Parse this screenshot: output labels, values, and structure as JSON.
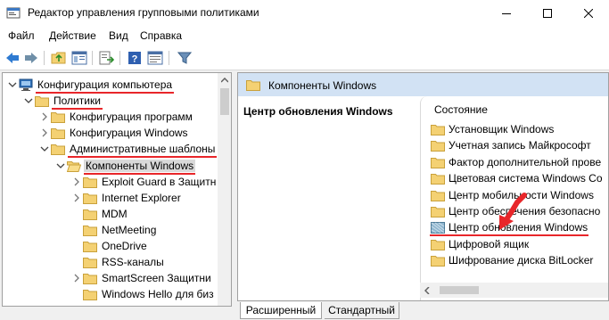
{
  "window": {
    "title": "Редактор управления групповыми политиками"
  },
  "menu": [
    "Файл",
    "Действие",
    "Вид",
    "Справка"
  ],
  "toolbar": {
    "icons": [
      "back-icon",
      "forward-icon",
      "folder-up-icon",
      "show-hide-tree-icon",
      "export-list-icon",
      "help-icon",
      "properties-icon",
      "filter-icon"
    ]
  },
  "tree": {
    "items": [
      {
        "label": "Конфигурация компьютера",
        "level": 0,
        "expander": "open",
        "icon": "computer-icon",
        "highlighted": true
      },
      {
        "label": "Политики",
        "level": 1,
        "expander": "open",
        "icon": "folder-icon",
        "highlighted": true
      },
      {
        "label": "Конфигурация программ",
        "level": 2,
        "expander": "closed",
        "icon": "folder-icon"
      },
      {
        "label": "Конфигурация Windows",
        "level": 2,
        "expander": "closed",
        "icon": "folder-icon"
      },
      {
        "label": "Административные шаблоны",
        "level": 2,
        "expander": "open",
        "icon": "folder-icon",
        "highlighted": true
      },
      {
        "label": "Компоненты Windows",
        "level": 3,
        "expander": "open",
        "icon": "folder-open-icon",
        "highlighted": true,
        "selected": true
      },
      {
        "label": "Exploit Guard в Защитн",
        "level": 4,
        "expander": "closed",
        "icon": "folder-icon"
      },
      {
        "label": "Internet Explorer",
        "level": 4,
        "expander": "closed",
        "icon": "folder-icon"
      },
      {
        "label": "MDM",
        "level": 4,
        "expander": "none",
        "icon": "folder-icon"
      },
      {
        "label": "NetMeeting",
        "level": 4,
        "expander": "none",
        "icon": "folder-icon"
      },
      {
        "label": "OneDrive",
        "level": 4,
        "expander": "none",
        "icon": "folder-icon"
      },
      {
        "label": "RSS-каналы",
        "level": 4,
        "expander": "none",
        "icon": "folder-icon"
      },
      {
        "label": "SmartScreen Защитни",
        "level": 4,
        "expander": "closed",
        "icon": "folder-icon"
      },
      {
        "label": "Windows Hello для биз",
        "level": 4,
        "expander": "none",
        "icon": "folder-icon"
      }
    ]
  },
  "right_pane": {
    "header_title": "Компоненты Windows",
    "section_heading": "Центр обновления Windows",
    "column_header": "Состояние",
    "items": [
      {
        "label": "Установщик Windows",
        "icon": "folder-icon"
      },
      {
        "label": "Учетная запись Майкрософт",
        "icon": "folder-icon"
      },
      {
        "label": "Фактор дополнительной прове",
        "icon": "folder-icon"
      },
      {
        "label": "Цветовая система Windows Co",
        "icon": "folder-icon"
      },
      {
        "label": "Центр мобильности Windows",
        "icon": "folder-icon"
      },
      {
        "label": "Центр обеспечения безопасно",
        "icon": "folder-icon"
      },
      {
        "label": "Центр обновления Windows",
        "icon": "folder-policy-icon",
        "highlighted": true
      },
      {
        "label": "Цифровой ящик",
        "icon": "folder-icon"
      },
      {
        "label": "Шифрование диска BitLocker",
        "icon": "folder-icon"
      }
    ]
  },
  "tabs": [
    {
      "label": "Расширенный",
      "active": true
    },
    {
      "label": "Стандартный",
      "active": false
    }
  ],
  "colors": {
    "annotation_red": "#e8262a",
    "header_blue": "#d2e2f4",
    "folder_yellow": "#f4d173"
  }
}
